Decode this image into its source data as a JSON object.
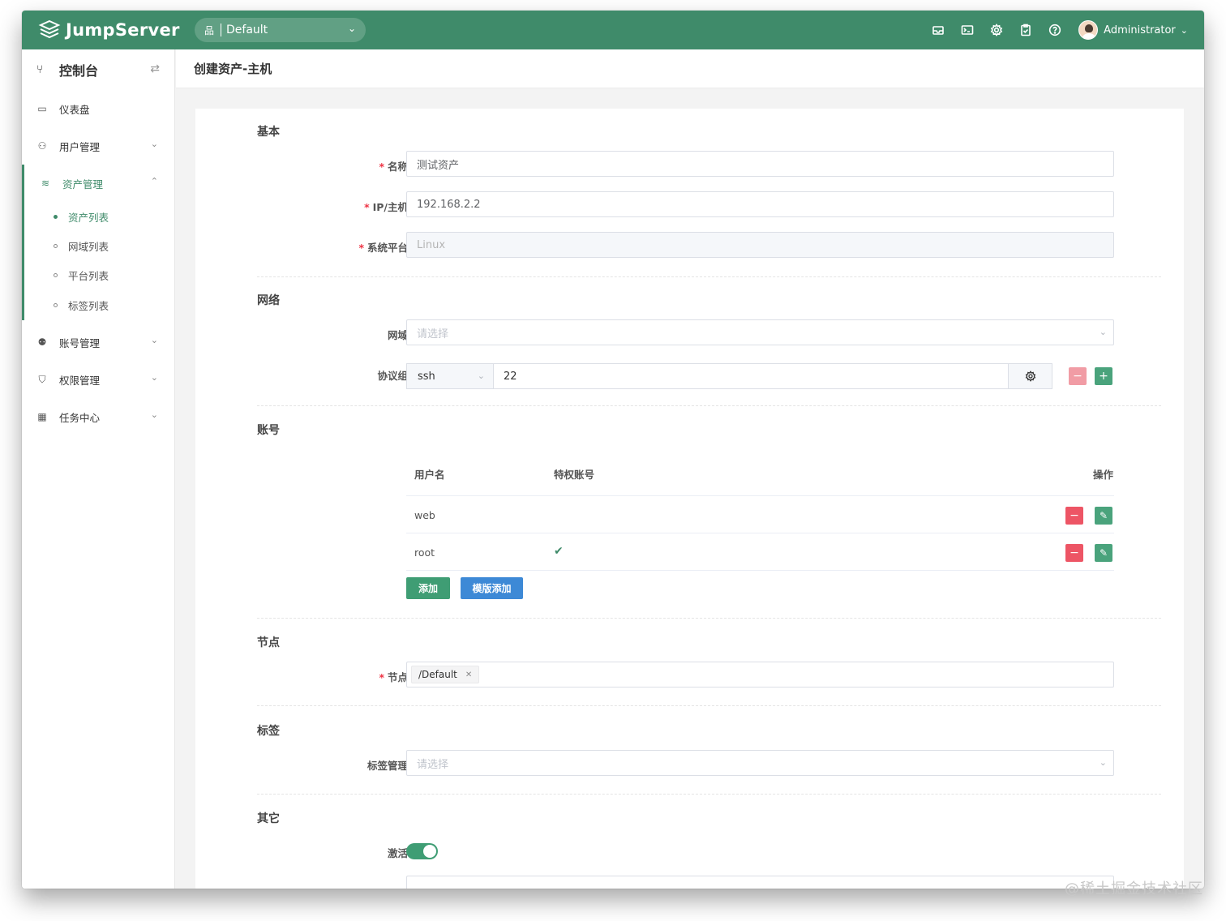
{
  "app": {
    "name": "JumpServer"
  },
  "header": {
    "org_select": "Default",
    "icons": [
      "inbox-icon",
      "terminal-icon",
      "settings-icon",
      "clipboard-icon",
      "help-icon"
    ],
    "user": "Administrator"
  },
  "sidebar": {
    "title": "控制台",
    "items": [
      {
        "label": "仪表盘",
        "icon": "dashboard-icon"
      },
      {
        "label": "用户管理",
        "icon": "users-icon"
      },
      {
        "label": "资产管理",
        "icon": "layers-icon"
      },
      {
        "label": "账号管理",
        "icon": "account-icon"
      },
      {
        "label": "权限管理",
        "icon": "shield-icon"
      },
      {
        "label": "任务中心",
        "icon": "calendar-icon"
      }
    ],
    "sub_items": [
      "资产列表",
      "网域列表",
      "平台列表",
      "标签列表"
    ]
  },
  "page": {
    "title": "创建资产-主机"
  },
  "form": {
    "basic": {
      "title": "基本",
      "name_label": "名称",
      "name_value": "测试资产",
      "ip_label": "IP/主机",
      "ip_value": "192.168.2.2",
      "platform_label": "系统平台",
      "platform_value": "Linux"
    },
    "network": {
      "title": "网络",
      "domain_label": "网域",
      "domain_placeholder": "请选择",
      "protocol_label": "协议组",
      "protocol_value": "ssh",
      "port_value": "22"
    },
    "accounts": {
      "title": "账号",
      "col_username": "用户名",
      "col_privileged": "特权账号",
      "col_actions": "操作",
      "rows": [
        {
          "username": "web",
          "privileged": false
        },
        {
          "username": "root",
          "privileged": true
        }
      ],
      "add_button": "添加",
      "template_add_button": "模版添加"
    },
    "nodes": {
      "title": "节点",
      "label": "节点",
      "tag": "/Default"
    },
    "labels": {
      "title": "标签",
      "label": "标签管理",
      "placeholder": "请选择"
    },
    "other": {
      "title": "其它",
      "active_label": "激活",
      "active_value": true
    }
  },
  "watermark": "@稀土掘金技术社区",
  "colors": {
    "brand": "#3f8b6a",
    "danger": "#ed5565",
    "info": "#3d89d6"
  }
}
